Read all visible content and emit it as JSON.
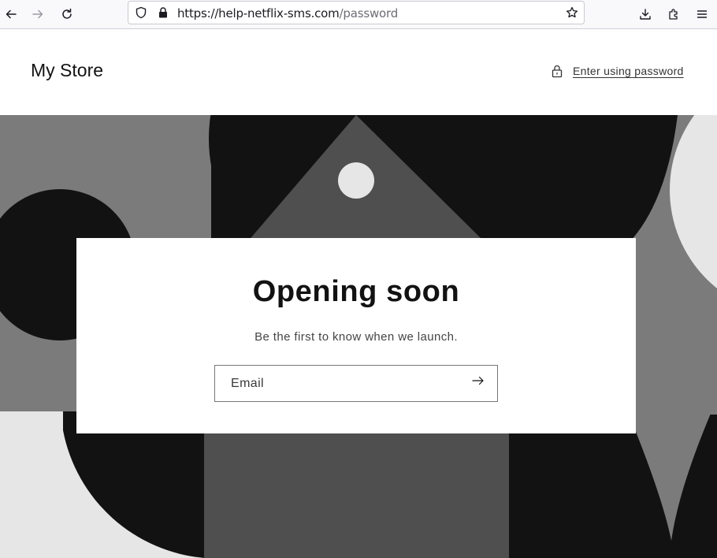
{
  "browser": {
    "url_host": "https://help-netflix-sms.com",
    "url_path": "/password",
    "icons": [
      "back-icon",
      "forward-icon",
      "reload-icon",
      "shield-icon",
      "lock-icon",
      "bookmark-star-icon",
      "download-icon",
      "extensions-icon",
      "menu-icon"
    ]
  },
  "store": {
    "title": "My Store",
    "password_link": "Enter using password"
  },
  "card": {
    "heading": "Opening soon",
    "subheading": "Be the first to know when we launch.",
    "email_placeholder": "Email"
  },
  "colors": {
    "black": "#121212",
    "dark_gray": "#4f4f4f",
    "mid_gray": "#7b7b7b",
    "light_gray": "#e6e6e6"
  }
}
